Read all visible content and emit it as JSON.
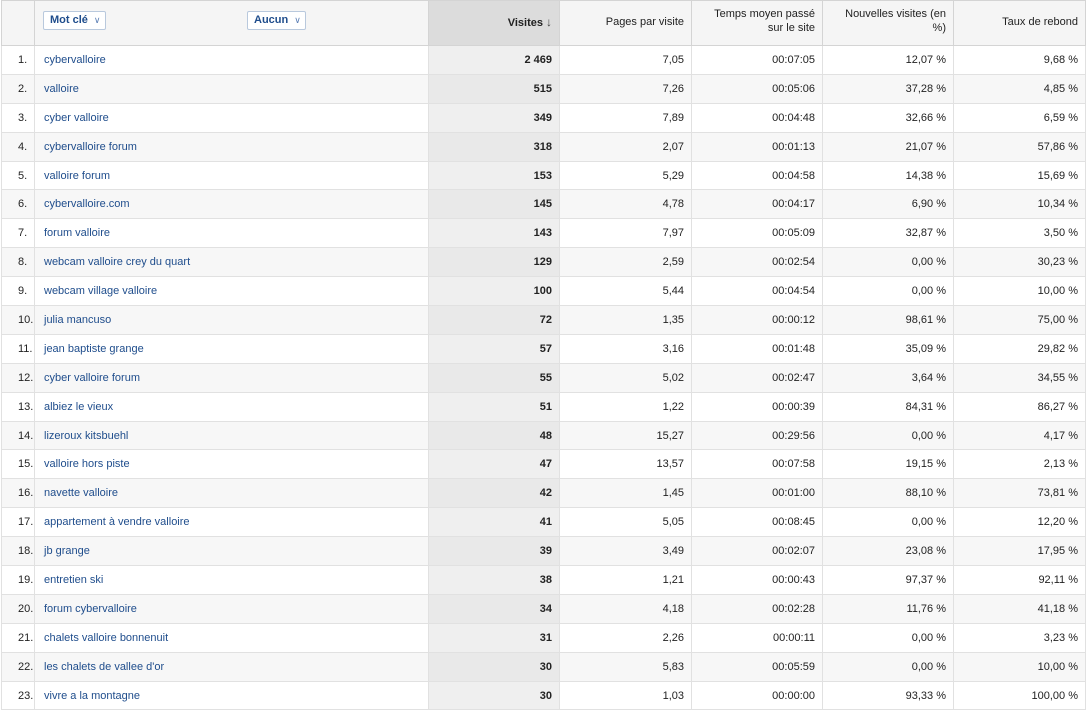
{
  "header": {
    "dimension1": "Mot clé",
    "dimension2": "Aucun",
    "visits": "Visites",
    "pages_per_visit": "Pages par visite",
    "avg_time": "Temps moyen passé sur le site",
    "new_visits": "Nouvelles visites (en %)",
    "bounce_rate": "Taux de rebond"
  },
  "rows": [
    {
      "idx": "1.",
      "keyword": "cybervalloire",
      "visits": "2 469",
      "ppv": "7,05",
      "time": "00:07:05",
      "nv": "12,07 %",
      "br": "9,68 %"
    },
    {
      "idx": "2.",
      "keyword": "valloire",
      "visits": "515",
      "ppv": "7,26",
      "time": "00:05:06",
      "nv": "37,28 %",
      "br": "4,85 %"
    },
    {
      "idx": "3.",
      "keyword": "cyber valloire",
      "visits": "349",
      "ppv": "7,89",
      "time": "00:04:48",
      "nv": "32,66 %",
      "br": "6,59 %"
    },
    {
      "idx": "4.",
      "keyword": "cybervalloire forum",
      "visits": "318",
      "ppv": "2,07",
      "time": "00:01:13",
      "nv": "21,07 %",
      "br": "57,86 %"
    },
    {
      "idx": "5.",
      "keyword": "valloire forum",
      "visits": "153",
      "ppv": "5,29",
      "time": "00:04:58",
      "nv": "14,38 %",
      "br": "15,69 %"
    },
    {
      "idx": "6.",
      "keyword": "cybervalloire.com",
      "visits": "145",
      "ppv": "4,78",
      "time": "00:04:17",
      "nv": "6,90 %",
      "br": "10,34 %"
    },
    {
      "idx": "7.",
      "keyword": "forum valloire",
      "visits": "143",
      "ppv": "7,97",
      "time": "00:05:09",
      "nv": "32,87 %",
      "br": "3,50 %"
    },
    {
      "idx": "8.",
      "keyword": "webcam valloire crey du quart",
      "visits": "129",
      "ppv": "2,59",
      "time": "00:02:54",
      "nv": "0,00 %",
      "br": "30,23 %"
    },
    {
      "idx": "9.",
      "keyword": "webcam village valloire",
      "visits": "100",
      "ppv": "5,44",
      "time": "00:04:54",
      "nv": "0,00 %",
      "br": "10,00 %"
    },
    {
      "idx": "10.",
      "keyword": "julia mancuso",
      "visits": "72",
      "ppv": "1,35",
      "time": "00:00:12",
      "nv": "98,61 %",
      "br": "75,00 %"
    },
    {
      "idx": "11.",
      "keyword": "jean baptiste grange",
      "visits": "57",
      "ppv": "3,16",
      "time": "00:01:48",
      "nv": "35,09 %",
      "br": "29,82 %"
    },
    {
      "idx": "12.",
      "keyword": "cyber valloire forum",
      "visits": "55",
      "ppv": "5,02",
      "time": "00:02:47",
      "nv": "3,64 %",
      "br": "34,55 %"
    },
    {
      "idx": "13.",
      "keyword": "albiez le vieux",
      "visits": "51",
      "ppv": "1,22",
      "time": "00:00:39",
      "nv": "84,31 %",
      "br": "86,27 %"
    },
    {
      "idx": "14.",
      "keyword": "lizeroux kitsbuehl",
      "visits": "48",
      "ppv": "15,27",
      "time": "00:29:56",
      "nv": "0,00 %",
      "br": "4,17 %"
    },
    {
      "idx": "15.",
      "keyword": "valloire hors piste",
      "visits": "47",
      "ppv": "13,57",
      "time": "00:07:58",
      "nv": "19,15 %",
      "br": "2,13 %"
    },
    {
      "idx": "16.",
      "keyword": "navette valloire",
      "visits": "42",
      "ppv": "1,45",
      "time": "00:01:00",
      "nv": "88,10 %",
      "br": "73,81 %"
    },
    {
      "idx": "17.",
      "keyword": "appartement à vendre valloire",
      "visits": "41",
      "ppv": "5,05",
      "time": "00:08:45",
      "nv": "0,00 %",
      "br": "12,20 %"
    },
    {
      "idx": "18.",
      "keyword": "jb grange",
      "visits": "39",
      "ppv": "3,49",
      "time": "00:02:07",
      "nv": "23,08 %",
      "br": "17,95 %"
    },
    {
      "idx": "19.",
      "keyword": "entretien ski",
      "visits": "38",
      "ppv": "1,21",
      "time": "00:00:43",
      "nv": "97,37 %",
      "br": "92,11 %"
    },
    {
      "idx": "20.",
      "keyword": "forum cybervalloire",
      "visits": "34",
      "ppv": "4,18",
      "time": "00:02:28",
      "nv": "11,76 %",
      "br": "41,18 %"
    },
    {
      "idx": "21.",
      "keyword": "chalets valloire bonnenuit",
      "visits": "31",
      "ppv": "2,26",
      "time": "00:00:11",
      "nv": "0,00 %",
      "br": "3,23 %"
    },
    {
      "idx": "22.",
      "keyword": "les chalets de vallee d'or",
      "visits": "30",
      "ppv": "5,83",
      "time": "00:05:59",
      "nv": "0,00 %",
      "br": "10,00 %"
    },
    {
      "idx": "23.",
      "keyword": "vivre a la montagne",
      "visits": "30",
      "ppv": "1,03",
      "time": "00:00:00",
      "nv": "93,33 %",
      "br": "100,00 %"
    }
  ]
}
